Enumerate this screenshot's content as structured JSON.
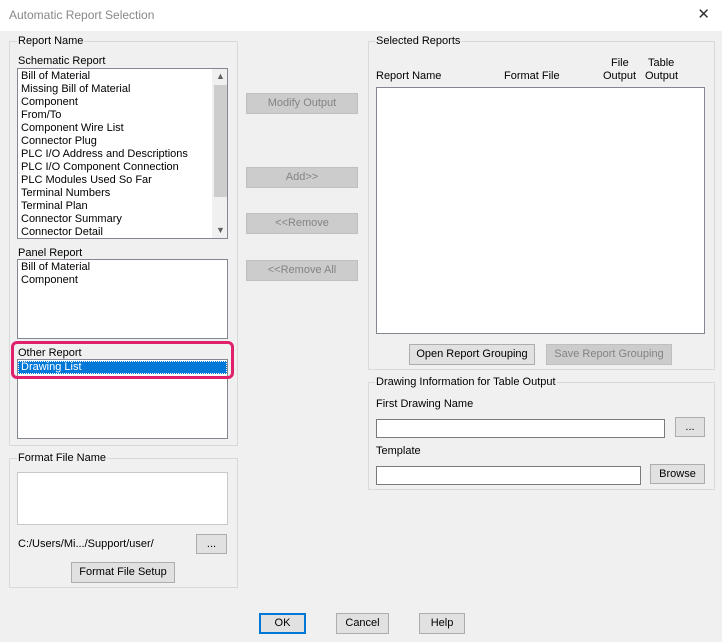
{
  "window": {
    "title": "Automatic Report Selection",
    "close_glyph": "✕"
  },
  "report_name": {
    "group_label": "Report Name",
    "schematic": {
      "label": "Schematic Report",
      "items": [
        "Bill of Material",
        "Missing Bill of Material",
        "Component",
        "From/To",
        "Component Wire List",
        "Connector Plug",
        "PLC I/O Address and Descriptions",
        "PLC I/O Component Connection",
        "PLC Modules Used So Far",
        "Terminal Numbers",
        "Terminal Plan",
        "Connector Summary",
        "Connector Detail"
      ]
    },
    "panel": {
      "label": "Panel Report",
      "items": [
        "Bill of Material",
        "Component"
      ]
    },
    "other": {
      "label": "Other Report",
      "items": [
        "Drawing List"
      ],
      "selected_index": 0
    }
  },
  "format_file": {
    "group_label": "Format File Name",
    "path": "C:/Users/Mi.../Support/user/",
    "browse_label": "...",
    "setup_label": "Format File Setup"
  },
  "middle_buttons": {
    "modify": "Modify Output",
    "add": "Add>>",
    "remove": "<<Remove",
    "remove_all": "<<Remove All"
  },
  "selected_reports": {
    "group_label": "Selected Reports",
    "columns": {
      "report_name": "Report Name",
      "format_file": "Format File",
      "file_output_1": "File",
      "file_output_2": "Output",
      "table_output_1": "Table",
      "table_output_2": "Output"
    },
    "open_grouping": "Open Report Grouping",
    "save_grouping": "Save Report Grouping"
  },
  "drawing_info": {
    "group_label": "Drawing Information for Table Output",
    "first_drawing_label": "First Drawing Name",
    "first_drawing_value": "",
    "first_drawing_browse": "...",
    "template_label": "Template",
    "template_value": "",
    "template_browse": "Browse"
  },
  "footer": {
    "ok": "OK",
    "cancel": "Cancel",
    "help": "Help"
  },
  "colors": {
    "highlight": "#e0206a",
    "selection": "#0078d7"
  }
}
